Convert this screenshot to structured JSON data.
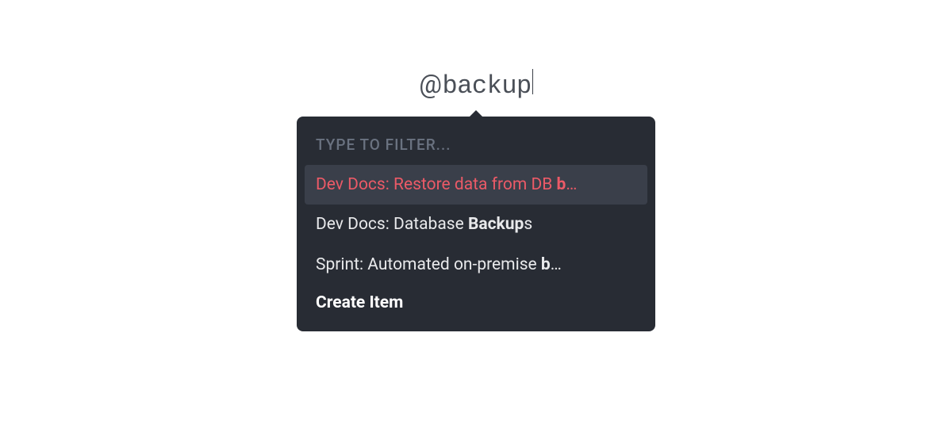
{
  "input": {
    "prefix": "@",
    "text": "backup"
  },
  "popover": {
    "filterLabel": "Type to filter...",
    "items": [
      {
        "prefix": "Dev Docs: Restore data from DB ",
        "bold": "b",
        "suffix": "…",
        "selected": true
      },
      {
        "prefix": "Dev Docs: Database ",
        "bold": "Backup",
        "suffix": "s",
        "selected": false
      },
      {
        "prefix": "Sprint: Automated on-premise ",
        "bold": "b",
        "suffix": "…",
        "selected": false
      }
    ],
    "createLabel": "Create Item"
  }
}
